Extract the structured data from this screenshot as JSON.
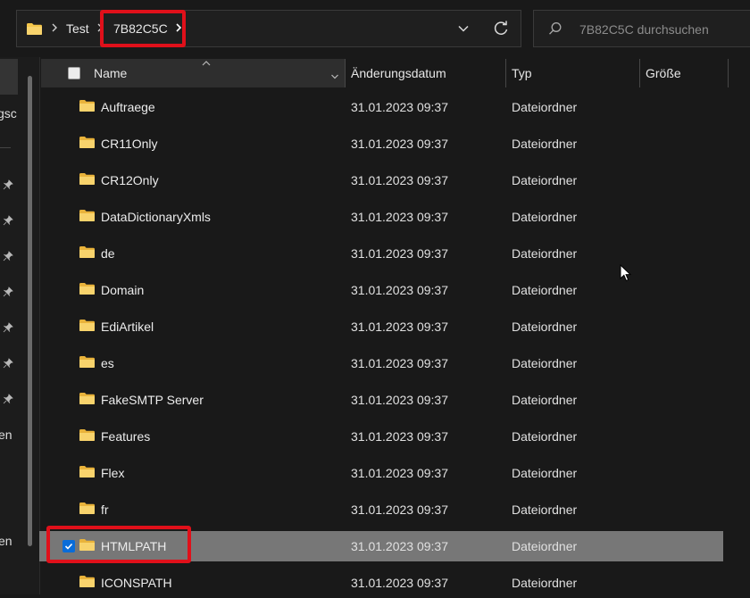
{
  "address_bar": {
    "crumbs": [
      "Test",
      "7B82C5C"
    ]
  },
  "search": {
    "placeholder": "7B82C5C durchsuchen"
  },
  "nav": {
    "labels": [
      "gsc",
      "en",
      "en"
    ]
  },
  "columns": {
    "name": "Name",
    "date": "Änderungsdatum",
    "type": "Typ",
    "size": "Größe"
  },
  "rows": [
    {
      "name": "Auftraege",
      "date": "31.01.2023 09:37",
      "type": "Dateiordner"
    },
    {
      "name": "CR11Only",
      "date": "31.01.2023 09:37",
      "type": "Dateiordner"
    },
    {
      "name": "CR12Only",
      "date": "31.01.2023 09:37",
      "type": "Dateiordner"
    },
    {
      "name": "DataDictionaryXmls",
      "date": "31.01.2023 09:37",
      "type": "Dateiordner"
    },
    {
      "name": "de",
      "date": "31.01.2023 09:37",
      "type": "Dateiordner"
    },
    {
      "name": "Domain",
      "date": "31.01.2023 09:37",
      "type": "Dateiordner"
    },
    {
      "name": "EdiArtikel",
      "date": "31.01.2023 09:37",
      "type": "Dateiordner"
    },
    {
      "name": "es",
      "date": "31.01.2023 09:37",
      "type": "Dateiordner"
    },
    {
      "name": "FakeSMTP Server",
      "date": "31.01.2023 09:37",
      "type": "Dateiordner"
    },
    {
      "name": "Features",
      "date": "31.01.2023 09:37",
      "type": "Dateiordner"
    },
    {
      "name": "Flex",
      "date": "31.01.2023 09:37",
      "type": "Dateiordner"
    },
    {
      "name": "fr",
      "date": "31.01.2023 09:37",
      "type": "Dateiordner"
    },
    {
      "name": "HTMLPATH",
      "date": "31.01.2023 09:37",
      "type": "Dateiordner",
      "selected": true
    },
    {
      "name": "ICONSPATH",
      "date": "31.01.2023 09:37",
      "type": "Dateiordner"
    }
  ],
  "colors": {
    "highlight_red": "#e0101a",
    "folder_yellow": "#f4c64a",
    "checkbox_blue": "#0a6cd8",
    "selected_row": "#777777"
  },
  "icons": [
    "folder-icon",
    "chevron-right-icon",
    "chevron-down-icon",
    "refresh-icon",
    "search-icon",
    "pin-icon",
    "checkbox-icon",
    "check-icon",
    "sort-caret-icon",
    "mouse-cursor-icon"
  ]
}
